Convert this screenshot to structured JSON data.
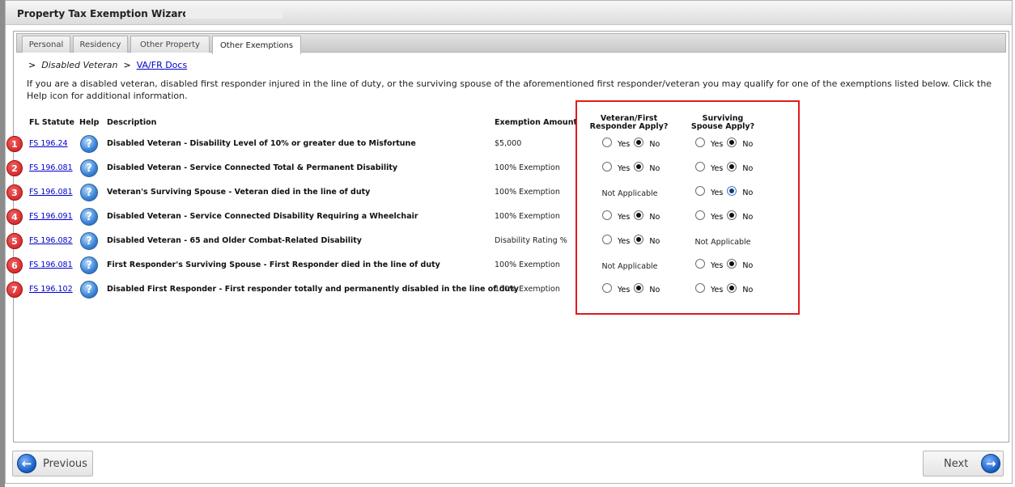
{
  "window": {
    "title": "Property Tax Exemption Wizard -"
  },
  "tabs": [
    {
      "label": "Personal"
    },
    {
      "label": "Residency"
    },
    {
      "label": "Other Property"
    },
    {
      "label": "Other Exemptions",
      "active": true
    }
  ],
  "breadcrumb": {
    "sep": ">",
    "current": "Disabled Veteran",
    "link": "VA/FR Docs"
  },
  "intro": "If you are a disabled veteran, disabled first responder injured in the line of duty, or the surviving spouse of the aforementioned first responder/veteran you may qualify for one of the exemptions listed below. Click the Help icon for additional information.",
  "headers": {
    "statute": "FL Statute",
    "help": "Help",
    "description": "Description",
    "amount": "Exemption Amount",
    "veteran_apply": "Veteran/First Responder Apply?",
    "spouse_apply": "Surviving Spouse Apply?"
  },
  "labels": {
    "yes": "Yes",
    "no": "No",
    "not_applicable": "Not Applicable"
  },
  "help_glyph": "?",
  "rows": [
    {
      "n": "1",
      "statute": "FS 196.24",
      "description": "Disabled Veteran - Disability Level of 10% or greater due to Misfortune",
      "amount": "$5,000",
      "veteran": "No",
      "spouse": "No"
    },
    {
      "n": "2",
      "statute": "FS 196.081",
      "description": "Disabled Veteran - Service Connected Total & Permanent Disability",
      "amount": "100% Exemption",
      "veteran": "No",
      "spouse": "No"
    },
    {
      "n": "3",
      "statute": "FS 196.081",
      "description": "Veteran's Surviving Spouse - Veteran died in the line of duty",
      "amount": "100% Exemption",
      "veteran": "Not Applicable",
      "spouse": "No"
    },
    {
      "n": "4",
      "statute": "FS 196.091",
      "description": "Disabled Veteran - Service Connected Disability Requiring a Wheelchair",
      "amount": "100% Exemption",
      "veteran": "No",
      "spouse": "No"
    },
    {
      "n": "5",
      "statute": "FS 196.082",
      "description": "Disabled Veteran - 65 and Older Combat-Related Disability",
      "amount": "Disability Rating %",
      "veteran": "No",
      "spouse": "Not Applicable"
    },
    {
      "n": "6",
      "statute": "FS 196.081",
      "description": "First Responder's Surviving Spouse - First Responder died in the line of duty",
      "amount": "100% Exemption",
      "veteran": "Not Applicable",
      "spouse": "No"
    },
    {
      "n": "7",
      "statute": "FS 196.102",
      "description": "Disabled First Responder - First responder totally and permanently disabled in the line of duty",
      "amount": "100% Exemption",
      "veteran": "No",
      "spouse": "No"
    }
  ],
  "buttons": {
    "previous": "Previous",
    "next": "Next"
  },
  "colors": {
    "highlight_box": "#e11b1b",
    "link": "#0000cc",
    "badge": "#c9181d"
  }
}
